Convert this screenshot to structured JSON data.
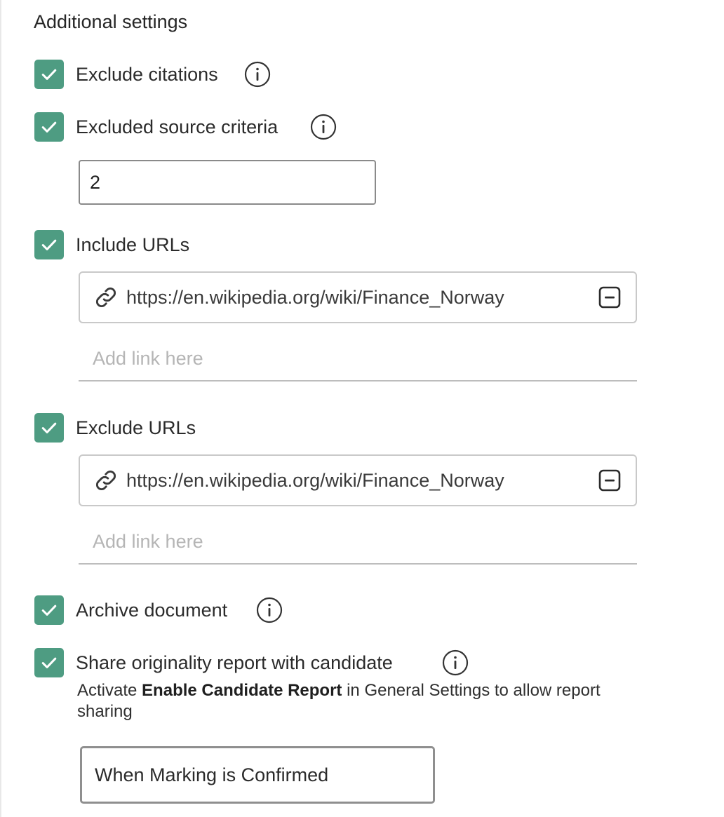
{
  "section": {
    "title": "Additional settings"
  },
  "options": {
    "exclude_citations": {
      "label": "Exclude citations",
      "checked": true
    },
    "excluded_source_criteria": {
      "label": "Excluded source criteria",
      "checked": true,
      "value": "2"
    },
    "include_urls": {
      "label": "Include URLs",
      "checked": true,
      "urls": [
        "https://en.wikipedia.org/wiki/Finance_Norway"
      ],
      "add_placeholder": "Add link here"
    },
    "exclude_urls": {
      "label": "Exclude URLs",
      "checked": true,
      "urls": [
        "https://en.wikipedia.org/wiki/Finance_Norway"
      ],
      "add_placeholder": "Add link here"
    },
    "archive_document": {
      "label": "Archive document",
      "checked": true
    },
    "share_report": {
      "label": "Share originality report with candidate",
      "checked": true,
      "helper_prefix": "Activate ",
      "helper_bold": "Enable Candidate Report",
      "helper_suffix": " in General Settings to allow report sharing",
      "selected": "When Marking is Confirmed"
    }
  },
  "icons": {
    "check": "check-icon",
    "info": "info-icon",
    "link": "link-icon",
    "remove": "minus-square-icon"
  },
  "colors": {
    "checkbox_fill": "#4e9c82",
    "placeholder": "#b5b5b5",
    "border_dark": "#8a8a8a",
    "border_light": "#c9c9c9"
  }
}
